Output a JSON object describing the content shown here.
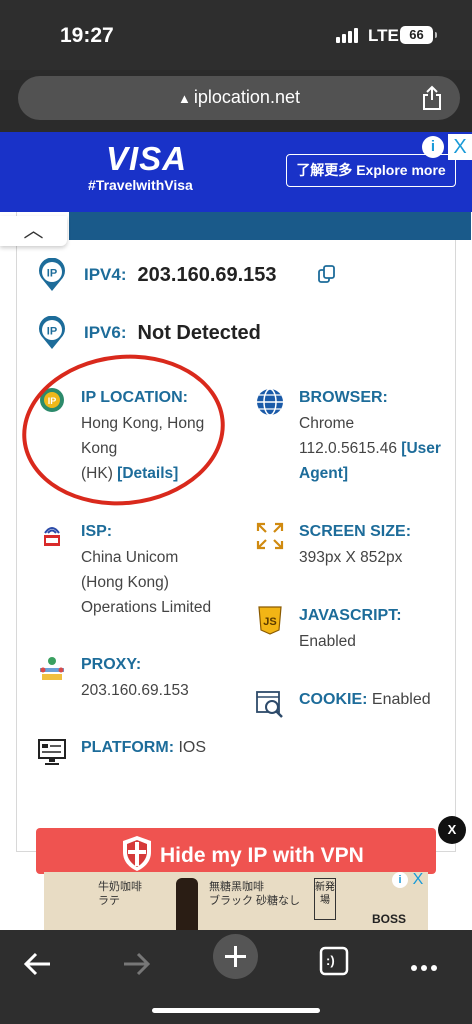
{
  "status": {
    "time": "19:27",
    "network": "LTE",
    "battery": "66"
  },
  "browser": {
    "url": "iplocation.net"
  },
  "top_ad": {
    "brand": "VISA",
    "tagline": "#TravelwithVisa",
    "cta": "了解更多 Explore more",
    "info": "i",
    "close": "X"
  },
  "collapse_icon": "chevron-up-icon",
  "ip": {
    "ipv4_label": "IPV4:",
    "ipv4_value": "203.160.69.153",
    "ipv6_label": "IPV6:",
    "ipv6_value": "Not Detected"
  },
  "details": {
    "location_label": "IP LOCATION:",
    "location_line1": "Hong Kong, Hong",
    "location_line2": "Kong",
    "location_line3": "(HK)",
    "location_link": "[Details]",
    "browser_label": "BROWSER:",
    "browser_line1": "Chrome",
    "browser_line2": "112.0.5615.46",
    "browser_link1": "[User",
    "browser_link2": "Agent]",
    "isp_label": "ISP:",
    "isp_line1": "China Unicom",
    "isp_line2": "(Hong Kong)",
    "isp_line3": "Operations Limited",
    "screen_label": "SCREEN SIZE:",
    "screen_value": "393px X 852px",
    "js_label": "JAVASCRIPT:",
    "js_value": "Enabled",
    "proxy_label": "PROXY:",
    "proxy_value": "203.160.69.153",
    "cookie_label": "COOKIE:",
    "cookie_value": "Enabled",
    "platform_label": "PLATFORM:",
    "platform_value": "IOS"
  },
  "vpn_button": "Hide my IP with VPN",
  "dismiss": "X",
  "bottom_ad": {
    "text1": "牛奶咖啡",
    "text2": "ラテ",
    "text3": "無糖黑咖啡",
    "text4": "ブラック 砂糖なし",
    "new_tag": "新発場",
    "brand": "BOSS",
    "info": "i",
    "close": "X"
  },
  "toolbar": {
    "tabs_glyph": ":)"
  },
  "colors": {
    "accent": "#1d6c9a",
    "visa_bg": "#1932c8",
    "vpn": "#ef5350",
    "highlight": "#d9291c"
  }
}
